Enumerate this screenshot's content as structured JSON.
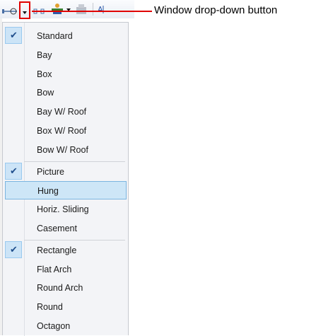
{
  "callout": {
    "text": "Window drop-down button"
  },
  "menu": {
    "groups": [
      [
        {
          "label": "Standard",
          "checked": true
        },
        {
          "label": "Bay"
        },
        {
          "label": "Box"
        },
        {
          "label": "Bow"
        },
        {
          "label": "Bay W/ Roof"
        },
        {
          "label": "Box W/ Roof"
        },
        {
          "label": "Bow W/ Roof"
        }
      ],
      [
        {
          "label": "Picture",
          "checked": true
        },
        {
          "label": "Hung",
          "highlighted": true
        },
        {
          "label": "Horiz. Sliding"
        },
        {
          "label": "Casement"
        }
      ],
      [
        {
          "label": "Rectangle",
          "checked": true
        },
        {
          "label": "Flat Arch"
        },
        {
          "label": "Round Arch"
        },
        {
          "label": "Round"
        },
        {
          "label": "Octagon"
        }
      ]
    ]
  },
  "colors": {
    "callout_red": "#e00000",
    "check_bg": "#cce4f7",
    "highlight": "#cde6f7"
  },
  "icons": [
    "door-icon",
    "dropdown-arrow-icon",
    "wall-icon",
    "stairs-icon",
    "cabinet-icon",
    "text-icon"
  ]
}
